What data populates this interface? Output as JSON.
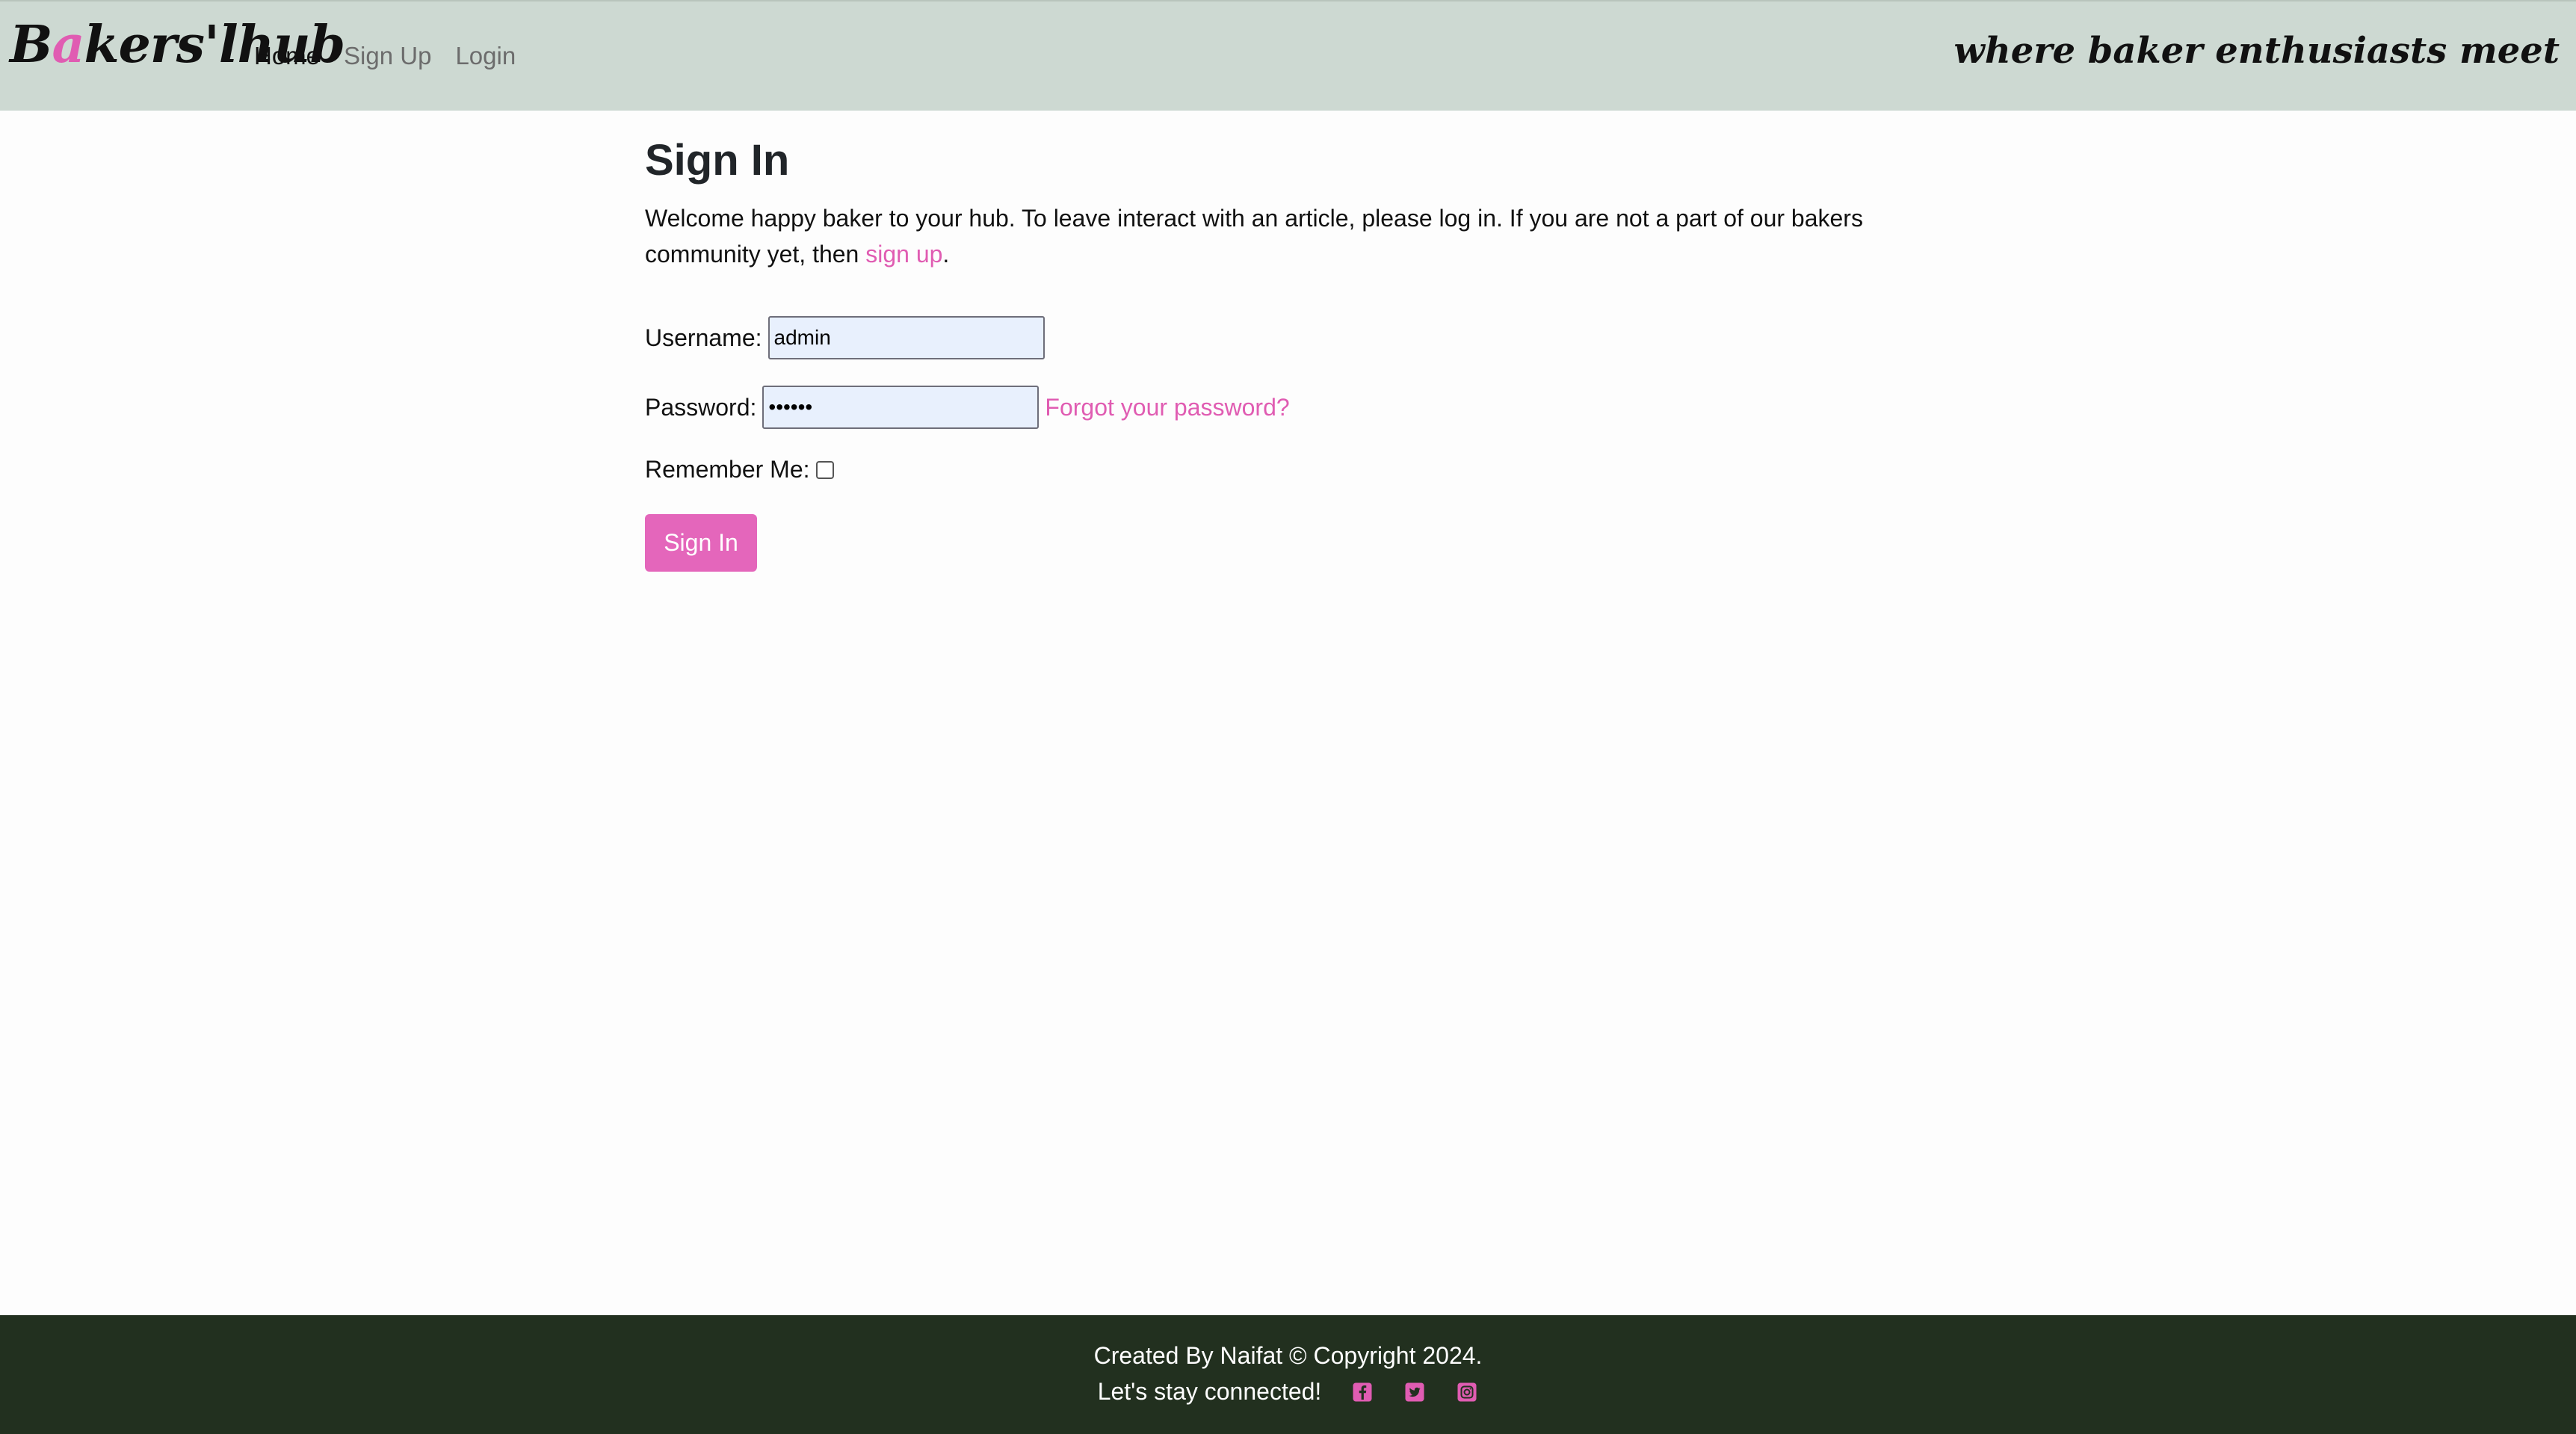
{
  "brand": {
    "before_accent": "B",
    "accent": "a",
    "after_accent": "kers'lhub"
  },
  "nav": {
    "items": [
      {
        "label": "Home"
      },
      {
        "label": "Sign Up"
      },
      {
        "label": "Login"
      }
    ],
    "tagline": "where baker enthusiasts meet"
  },
  "main": {
    "title": "Sign In",
    "intro_text": "Welcome happy baker to your hub. To leave interact with an article, please log in. If you are not a part of our bakers community yet, then ",
    "intro_link": "sign up",
    "intro_end": "."
  },
  "form": {
    "username_label": "Username:",
    "username_value": "admin",
    "password_label": "Password:",
    "password_value": "••••••",
    "forgot_label": "Forgot your password?",
    "remember_label": "Remember Me:",
    "remember_checked": false,
    "submit_label": "Sign In"
  },
  "footer": {
    "credit": "Created By Naifat © Copyright 2024.",
    "connect": "Let's stay connected!",
    "social_icons": [
      "facebook-icon",
      "twitter-icon",
      "instagram-icon"
    ]
  },
  "colors": {
    "navbar_bg": "#cdd9d2",
    "accent_pink": "#e05cb2",
    "button_pink": "#e466bb",
    "footer_bg": "#22301f",
    "input_bg": "#e8f0fd"
  }
}
